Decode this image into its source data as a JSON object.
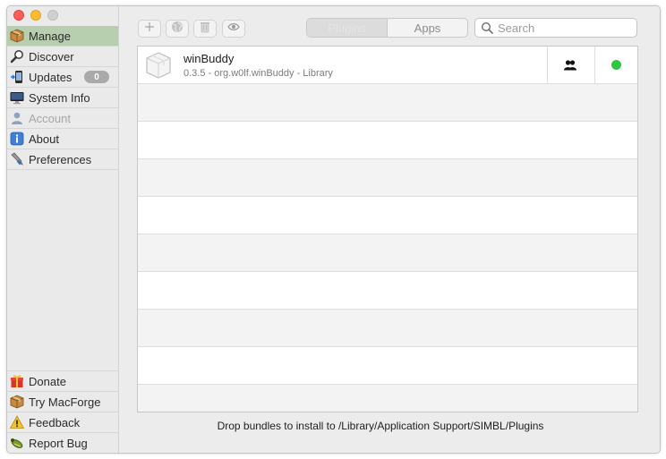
{
  "window": {
    "controls": [
      "close",
      "minimize",
      "zoom"
    ]
  },
  "sidebar": {
    "items": [
      {
        "label": "Manage",
        "icon": "box-icon",
        "selected": true
      },
      {
        "label": "Discover",
        "icon": "magnifier-icon"
      },
      {
        "label": "Updates",
        "icon": "update-icon",
        "badge": "0"
      },
      {
        "label": "System Info",
        "icon": "monitor-icon"
      },
      {
        "label": "Account",
        "icon": "person-icon",
        "disabled": true
      },
      {
        "label": "About",
        "icon": "info-icon"
      },
      {
        "label": "Preferences",
        "icon": "tools-icon"
      }
    ],
    "bottom_items": [
      {
        "label": "Donate",
        "icon": "gift-icon"
      },
      {
        "label": "Try MacForge",
        "icon": "box-icon"
      },
      {
        "label": "Feedback",
        "icon": "warning-icon"
      },
      {
        "label": "Report Bug",
        "icon": "bug-icon"
      }
    ]
  },
  "toolbar": {
    "buttons": [
      "add-icon",
      "globe-icon",
      "trash-icon",
      "eye-icon"
    ],
    "segments": [
      "Plugins",
      "Apps"
    ],
    "active_segment": "Plugins",
    "search_placeholder": "Search"
  },
  "plugins": [
    {
      "name": "winBuddy",
      "detail": "0.3.5 - org.w0lf.winBuddy - Library",
      "icon": "bundle-icon",
      "users_icon": "users-icon",
      "status_color": "#2bc93d"
    }
  ],
  "footer": {
    "drop_text": "Drop bundles to install to /Library/Application Support/SIMBL/Plugins"
  },
  "colors": {
    "selected_row": "#b7cfae",
    "status_enabled": "#2bc93d",
    "close": "#fc5f57",
    "minimize": "#fdbc2e"
  }
}
